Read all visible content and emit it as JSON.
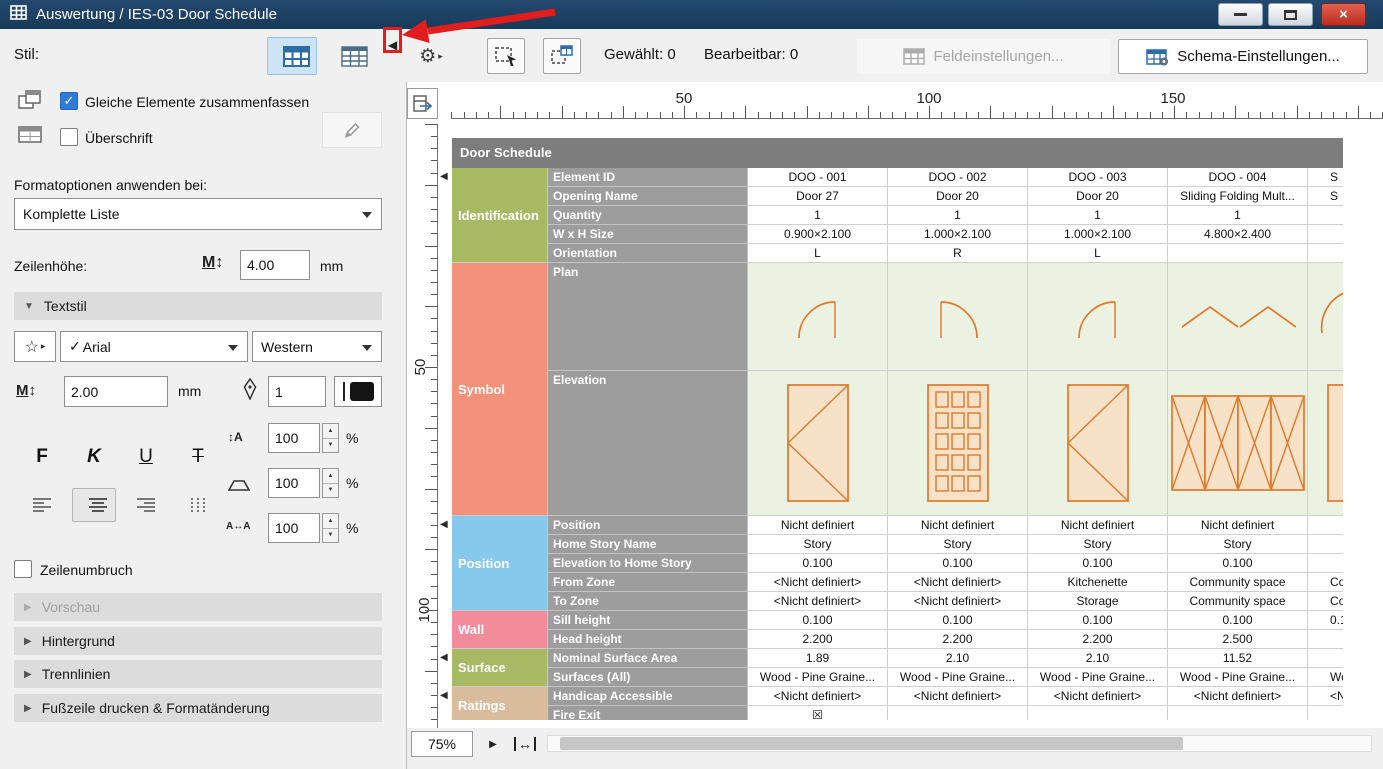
{
  "colors": {
    "titlebar": "#1b3c5d",
    "accent_blue": "#2f7cd6",
    "close_red": "#c0392b",
    "annotation_red": "#e11d1d",
    "symbol_stroke": "#e0782a",
    "symbol_fill": "#f7e2c8"
  },
  "window": {
    "title": "Auswertung / IES-03 Door Schedule"
  },
  "icons": {
    "gear": "⚙",
    "menu_arrow": "▸",
    "collapse_left": "◀",
    "star": "☆",
    "checkmark": "✓",
    "section_collapsed": "▶",
    "section_expanded": "▼",
    "spin_up": "▲",
    "spin_down": "▼",
    "close": "×",
    "play": "▶",
    "fit_arrow": "↔",
    "row_marker": "◀",
    "updown_arrow": "↕",
    "lr_arrow": "↔",
    "m_letter": "M",
    "letter_a": "A"
  },
  "toolbar": {
    "style_label": "Stil:",
    "selected_label": "Gewählt: 0",
    "editable_label": "Bearbeitbar: 0",
    "field_settings_label": "Feldeinstellungen...",
    "schema_settings_label": "Schema-Einstellungen..."
  },
  "options_panel": {
    "merge_label": "Gleiche Elemente zusammenfassen",
    "heading_label": "Überschrift",
    "format_apply_label": "Formatoptionen anwenden bei:",
    "format_apply_value": "Komplette Liste",
    "row_height_label": "Zeilenhöhe:",
    "row_height_value": "4.00",
    "row_height_unit": "mm",
    "text_style_title": "Textstil",
    "font_value": "Arial",
    "script_value": "Western",
    "font_size_value": "2.00",
    "font_size_unit": "mm",
    "pen_value": "1",
    "bold_label": "F",
    "italic_label": "K",
    "underline_label": "U",
    "strike_label": "T",
    "spacings": [
      "100",
      "100",
      "100"
    ],
    "percent": "%",
    "wrap_label": "Zeilenumbruch",
    "sections": [
      {
        "label": "Vorschau",
        "disabled": true
      },
      {
        "label": "Hintergrund",
        "disabled": false
      },
      {
        "label": "Trennlinien",
        "disabled": false
      },
      {
        "label": "Fußzeile drucken & Formatänderung",
        "disabled": false
      }
    ]
  },
  "preview": {
    "zoom_value": "75%",
    "h_ruler_marks": [
      "50",
      "100",
      "150"
    ],
    "v_ruler_marks": [
      "50",
      "100"
    ]
  },
  "schedule": {
    "title": "Door Schedule",
    "groups": [
      {
        "name": "Identification",
        "color": "#a8b964",
        "rows": [
          {
            "label": "Element ID",
            "values": [
              "DOO - 001",
              "DOO - 002",
              "DOO - 003",
              "DOO - 004",
              "S"
            ]
          },
          {
            "label": "Opening Name",
            "values": [
              "Door 27",
              "Door 20",
              "Door 20",
              "Sliding Folding Mult...",
              "S"
            ]
          },
          {
            "label": "Quantity",
            "values": [
              "1",
              "1",
              "1",
              "1",
              ""
            ]
          },
          {
            "label": "W x H Size",
            "values": [
              "0.900×2.100",
              "1.000×2.100",
              "1.000×2.100",
              "4.800×2.400",
              ""
            ]
          },
          {
            "label": "Orientation",
            "values": [
              "L",
              "R",
              "L",
              "",
              ""
            ]
          }
        ]
      },
      {
        "name": "Symbol",
        "color": "#f4917b",
        "rows": [
          {
            "label": "Plan",
            "h": 108,
            "symbols": [
              "plan-swing-door-left",
              "plan-swing-door-right",
              "plan-swing-door-left",
              "plan-folding-door",
              "plan-partial"
            ]
          },
          {
            "label": "Elevation",
            "h": 145,
            "symbols": [
              "elevation-door-diagonal",
              "elevation-door-glazed-grid",
              "elevation-door-diagonal",
              "elevation-folding-4-panel",
              "elevation-partial"
            ]
          }
        ]
      },
      {
        "name": "Position",
        "color": "#87c9ed",
        "rows": [
          {
            "label": "Position",
            "values": [
              "Nicht definiert",
              "Nicht definiert",
              "Nicht definiert",
              "Nicht definiert",
              ""
            ]
          },
          {
            "label": "Home Story Name",
            "values": [
              "Story",
              "Story",
              "Story",
              "Story",
              ""
            ]
          },
          {
            "label": "Elevation to Home Story",
            "values": [
              "0.100",
              "0.100",
              "0.100",
              "0.100",
              ""
            ]
          },
          {
            "label": "From Zone",
            "values": [
              "<Nicht definiert>",
              "<Nicht definiert>",
              "Kitchenette",
              "Community space",
              "Co"
            ]
          },
          {
            "label": "To Zone",
            "values": [
              "<Nicht definiert>",
              "<Nicht definiert>",
              "Storage",
              "Community space",
              "Co"
            ]
          }
        ]
      },
      {
        "name": "Wall",
        "color": "#f28b9b",
        "rows": [
          {
            "label": "Sill height",
            "values": [
              "0.100",
              "0.100",
              "0.100",
              "0.100",
              "0.1"
            ]
          },
          {
            "label": "Head height",
            "values": [
              "2.200",
              "2.200",
              "2.200",
              "2.500",
              ""
            ]
          }
        ]
      },
      {
        "name": "Surface",
        "color": "#a8b964",
        "rows": [
          {
            "label": "Nominal Surface Area",
            "values": [
              "1.89",
              "2.10",
              "2.10",
              "11.52",
              ""
            ]
          },
          {
            "label": "Surfaces (All)",
            "values": [
              "Wood - Pine Graine...",
              "Wood - Pine Graine...",
              "Wood - Pine Graine...",
              "Wood - Pine Graine...",
              "Woo"
            ]
          }
        ]
      },
      {
        "name": "Ratings",
        "color": "#d9bc9c",
        "rows": [
          {
            "label": "Handicap Accessible",
            "values": [
              "<Nicht definiert>",
              "<Nicht definiert>",
              "<Nicht definiert>",
              "<Nicht definiert>",
              "<N"
            ]
          },
          {
            "label": "Fire Exit",
            "values": [
              "☒",
              "",
              "",
              "",
              ""
            ]
          }
        ]
      }
    ]
  }
}
